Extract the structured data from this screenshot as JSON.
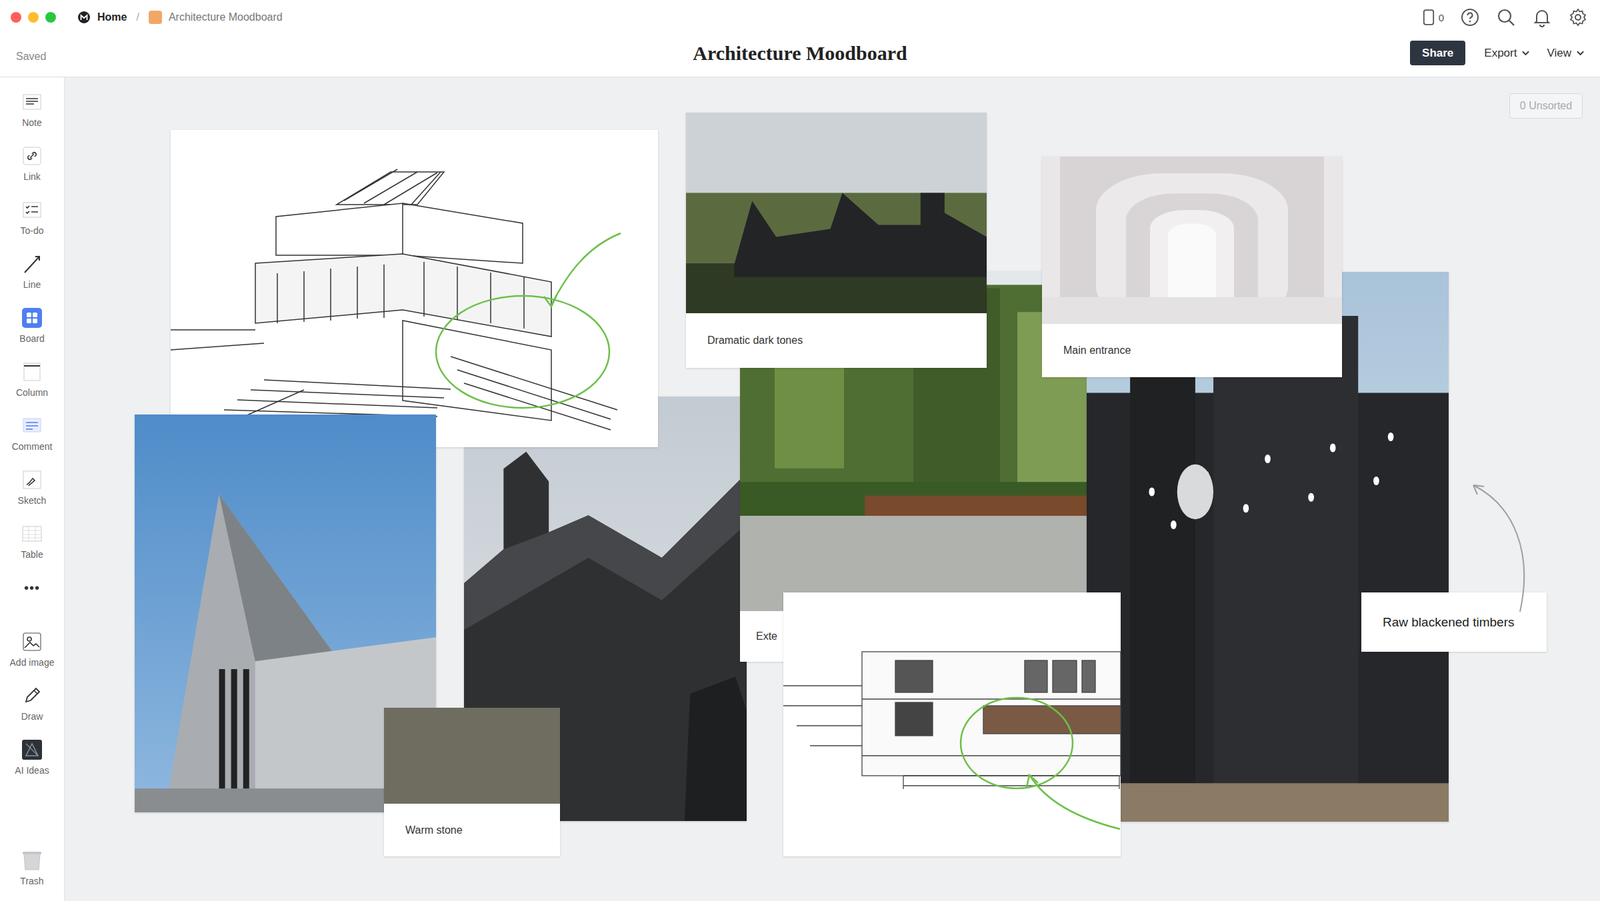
{
  "window": {
    "title": "Architecture Moodboard",
    "breadcrumb": [
      {
        "label": "Home",
        "kind": "home"
      },
      {
        "label": "Architecture Moodboard",
        "kind": "board"
      }
    ]
  },
  "status": "Saved",
  "header": {
    "device_count": "0",
    "buttons": [
      {
        "label": "Share",
        "kind": "primary"
      },
      {
        "label": "Export",
        "kind": "menu"
      },
      {
        "label": "View",
        "kind": "menu"
      }
    ]
  },
  "toolbar": [
    {
      "label": "Note",
      "kind": "note"
    },
    {
      "label": "Link",
      "kind": "link"
    },
    {
      "label": "To-do",
      "kind": "todo"
    },
    {
      "label": "Line",
      "kind": "line"
    },
    {
      "label": "Board",
      "kind": "board"
    },
    {
      "label": "Column",
      "kind": "column"
    },
    {
      "label": "Comment",
      "kind": "comment"
    },
    {
      "label": "Sketch",
      "kind": "sketch"
    },
    {
      "label": "Table",
      "kind": "table"
    },
    {
      "label": "•••",
      "kind": "more"
    },
    {
      "label": "Add image",
      "kind": "image"
    },
    {
      "label": "Draw",
      "kind": "draw"
    },
    {
      "label": "AI Ideas",
      "kind": "ai"
    }
  ],
  "trash": {
    "label": "Trash"
  },
  "unsorted": "0 Unsorted",
  "cards": [
    {
      "kind": "photo"
    },
    {
      "kind": "photo",
      "caption": "Exte"
    },
    {
      "kind": "sketch"
    },
    {
      "kind": "photo"
    },
    {
      "kind": "swatch",
      "caption": "Warm stone",
      "color": "#6e6d60"
    },
    {
      "kind": "photo",
      "caption": "Dramatic dark tones"
    },
    {
      "kind": "photo"
    },
    {
      "kind": "photo",
      "caption": "Main entrance"
    },
    {
      "kind": "sketch"
    },
    {
      "kind": "note",
      "text": "Raw blackened timbers"
    }
  ]
}
